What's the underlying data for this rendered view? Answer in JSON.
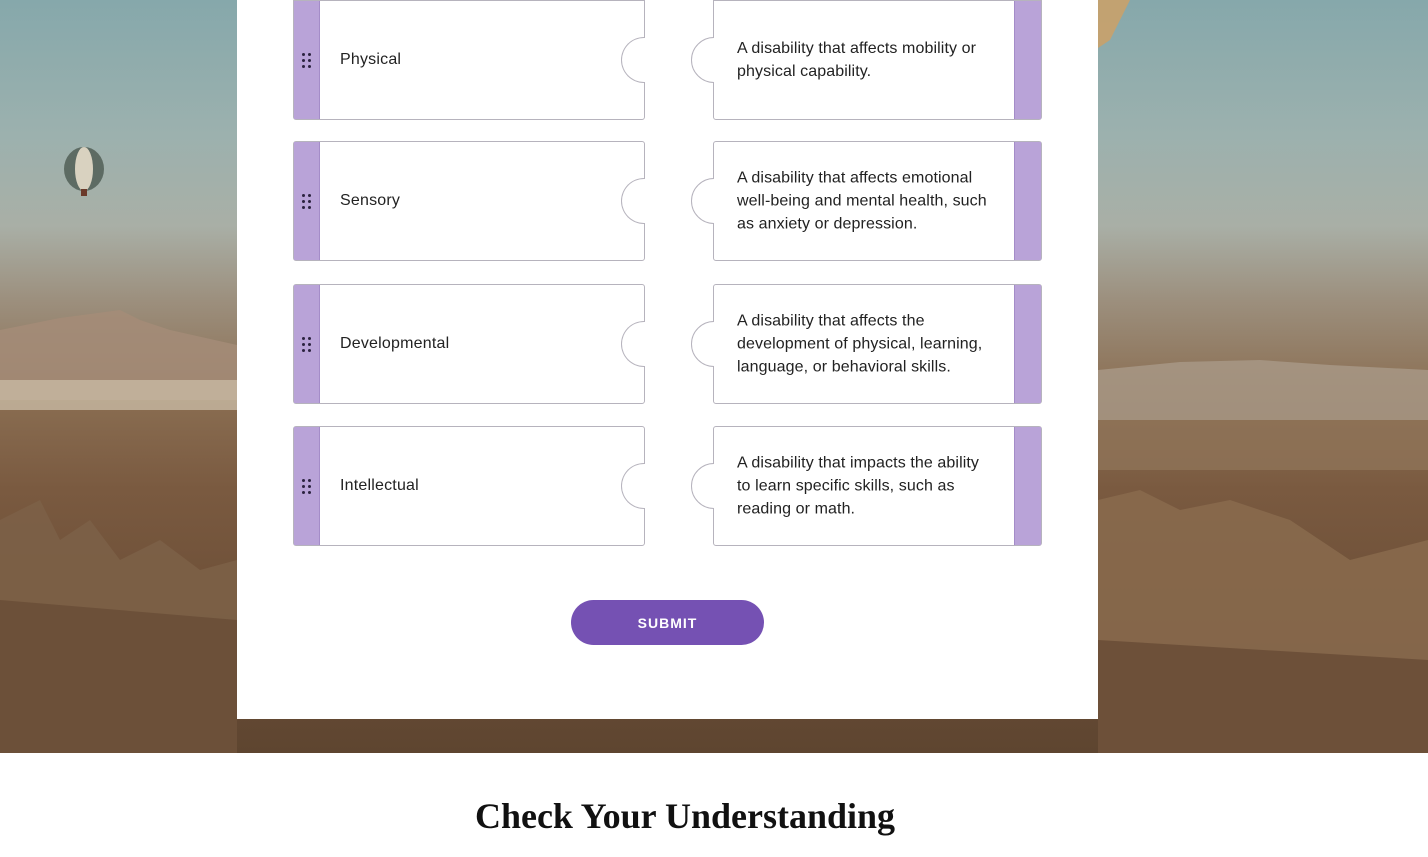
{
  "pairs": [
    {
      "term": "Physical",
      "definition": "A disability that affects mobility or physical capability."
    },
    {
      "term": "Sensory",
      "definition": "A disability that affects emotional well-being and mental health, such as anxiety or depression."
    },
    {
      "term": "Developmental",
      "definition": "A disability that affects the development of physical, learning, language, or behavioral skills."
    },
    {
      "term": "Intellectual",
      "definition": "A disability that impacts the ability to learn specific skills, such as reading or math."
    }
  ],
  "submit_label": "SUBMIT",
  "next_section_title": "Check Your Understanding",
  "icons": {
    "drag_handle": "drag-handle-icon"
  },
  "colors": {
    "accent": "#7551b3",
    "handle": "#b9a3d8"
  }
}
